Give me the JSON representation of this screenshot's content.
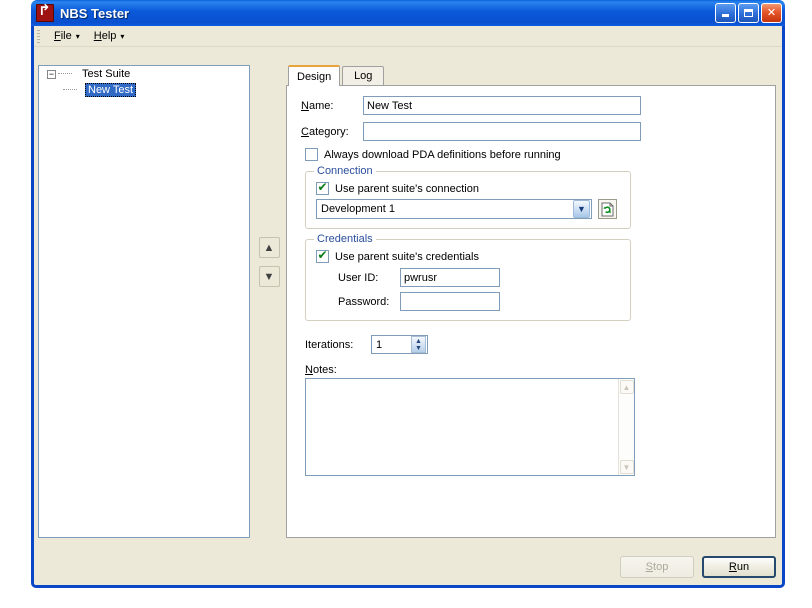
{
  "window": {
    "title": "NBS Tester",
    "app_icon": "app-logo-icon",
    "controls": {
      "minimize": "minimize-icon",
      "maximize": "maximize-icon",
      "close": "close-icon"
    }
  },
  "menubar": {
    "items": [
      {
        "label": "File",
        "mnemonic": "F",
        "rest": "ile",
        "caret": "▾"
      },
      {
        "label": "Help",
        "mnemonic": "H",
        "rest": "elp",
        "caret": "▾"
      }
    ]
  },
  "tree": {
    "root": {
      "label": "Test Suite",
      "expander": "−"
    },
    "child": {
      "label": "New Test",
      "selected": true
    }
  },
  "reorder": {
    "up": "▲",
    "down": "▼",
    "up_name": "move-up",
    "down_name": "move-down"
  },
  "tabs": [
    {
      "label": "Design",
      "active": true
    },
    {
      "label": "Log",
      "active": false
    }
  ],
  "form": {
    "name": {
      "label_mn": "N",
      "label_rest": "ame:",
      "value": "New Test"
    },
    "category": {
      "label_mn": "C",
      "label_rest": "ategory:",
      "value": ""
    },
    "always_download": {
      "label": "Always download PDA definitions before running",
      "checked": false
    },
    "connection": {
      "legend": "Connection",
      "use_parent": {
        "label": "Use parent suite's connection",
        "checked": true
      },
      "combo_value": "Development 1",
      "combo_caret": "▼",
      "refresh_icon": "refresh-icon"
    },
    "credentials": {
      "legend": "Credentials",
      "use_parent": {
        "label": "Use parent suite's credentials",
        "checked": true
      },
      "user_id": {
        "label": "User ID:",
        "value": "pwrusr"
      },
      "password": {
        "label": "Password:",
        "value": ""
      }
    },
    "iterations": {
      "label": "Iterations:",
      "value": "1",
      "up": "▲",
      "down": "▼"
    },
    "notes": {
      "label_mn": "N",
      "label_rest": "otes:",
      "value": "",
      "scroll_up": "▲",
      "scroll_down": "▼"
    }
  },
  "footer": {
    "stop": {
      "mn": "S",
      "rest": "top",
      "enabled": false
    },
    "run": {
      "mn": "R",
      "rest": "un",
      "default": true
    }
  },
  "colors": {
    "titlebar_blue": "#0b5ada",
    "window_border": "#0a46c8",
    "face": "#ece9d8",
    "selection": "#316ac5",
    "group_legend": "#2a4e9c",
    "tab_accent": "#e8a33d",
    "check_green": "#0a7a16"
  }
}
